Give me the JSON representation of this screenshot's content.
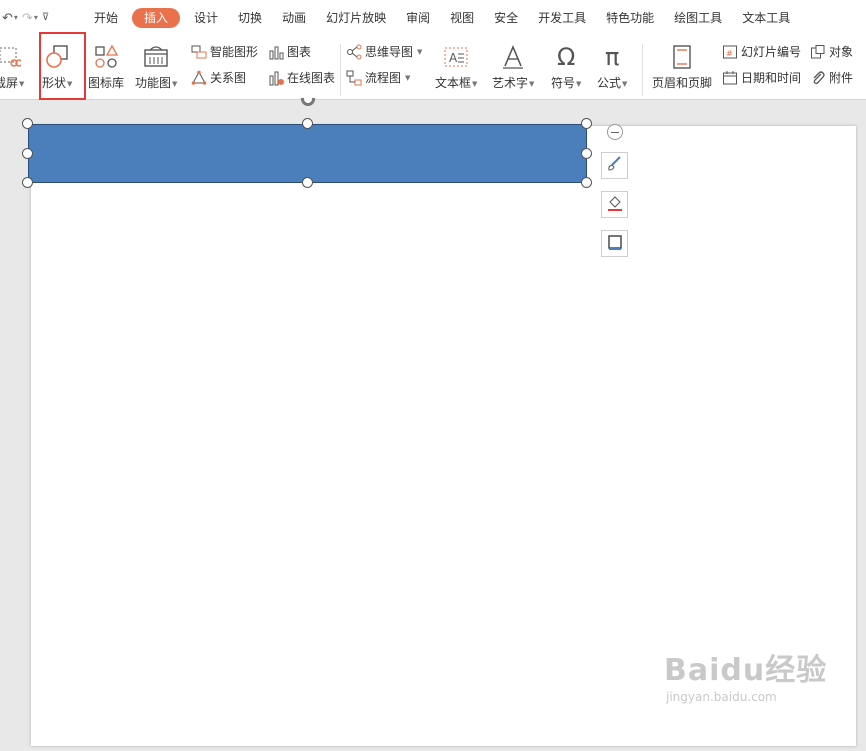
{
  "quick_access": {
    "undo_icon": "undo-icon",
    "redo_icon": "redo-icon",
    "customize_icon": "customize-icon"
  },
  "menu": {
    "tabs": [
      "开始",
      "插入",
      "设计",
      "切换",
      "动画",
      "幻灯片放映",
      "审阅",
      "视图",
      "安全",
      "开发工具",
      "特色功能",
      "绘图工具",
      "文本工具"
    ],
    "active_tab": "插入",
    "active_color": "#e9724d"
  },
  "ribbon": {
    "screenshot": "截屏",
    "shapes": "形状",
    "icon_library": "图标库",
    "function_chart": "功能图",
    "smart_art": "智能图形",
    "chart": "图表",
    "relation_chart": "关系图",
    "online_chart": "在线图表",
    "mind_map": "思维导图",
    "flowchart": "流程图",
    "text_box": "文本框",
    "word_art": "艺术字",
    "symbol": "符号",
    "formula": "公式",
    "header_footer": "页眉和页脚",
    "slide_number": "幻灯片编号",
    "date_time": "日期和时间",
    "object": "对象",
    "attachment": "附件"
  },
  "slide": {
    "shape_fill": "#4b7fbb",
    "shape_border": "#2b4f7a"
  },
  "highlight_color": "#e53935",
  "watermark": {
    "brand": "Baidu经验",
    "url": "jingyan.baidu.com"
  }
}
